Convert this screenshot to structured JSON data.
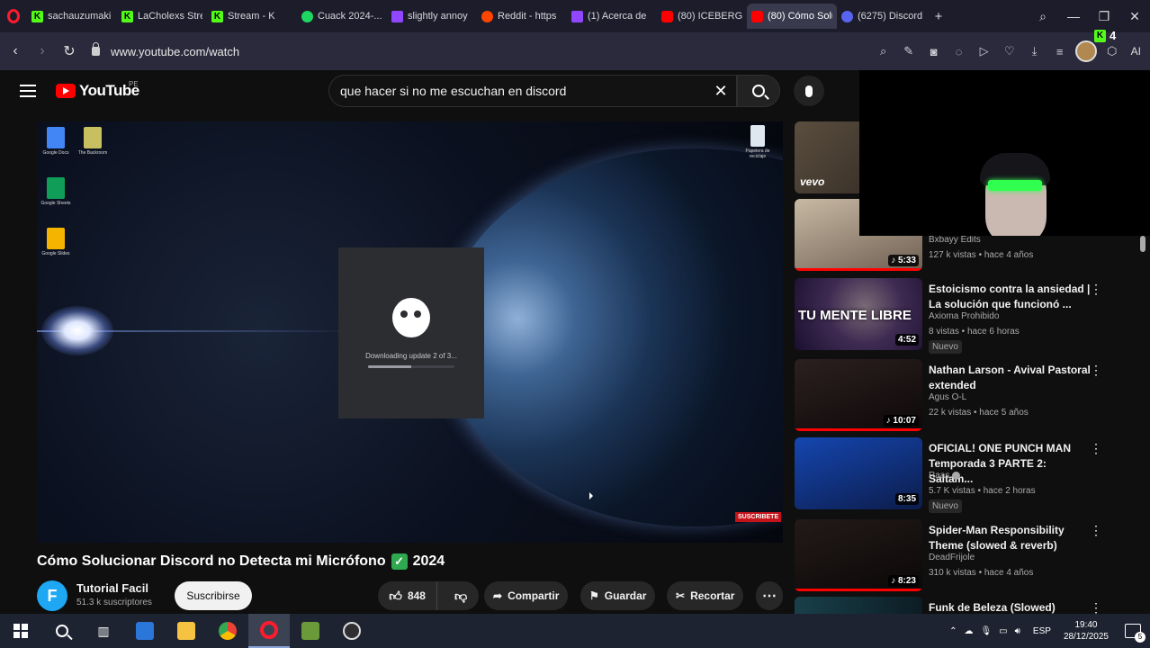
{
  "browser": {
    "tabs": [
      {
        "label": "sachauzumaki",
        "favicon": "kick-icon",
        "active": false
      },
      {
        "label": "LaCholexs Stre",
        "favicon": "kick-icon",
        "active": false
      },
      {
        "label": "Stream - K",
        "favicon": "kick-icon",
        "active": false
      },
      {
        "label": "Cuack 2024-...",
        "favicon": "spotify-icon",
        "active": false
      },
      {
        "label": "slightly annoy",
        "favicon": "twitch-icon",
        "active": false
      },
      {
        "label": "Reddit - https",
        "favicon": "reddit-icon",
        "active": false
      },
      {
        "label": "(1) Acerca de",
        "favicon": "twitch-icon",
        "active": false
      },
      {
        "label": "(80) ICEBERG",
        "favicon": "youtube-icon",
        "active": false
      },
      {
        "label": "(80) Cómo Solucion",
        "favicon": "youtube-icon",
        "active": true
      },
      {
        "label": "(6275) Discord",
        "favicon": "discord-icon",
        "active": false
      }
    ],
    "url": "www.youtube.com/watch",
    "ai_label": "AI",
    "extension_badge": "4"
  },
  "youtube": {
    "logo_text": "YouTube",
    "region": "PE",
    "search_query": "que hacer si no me escuchan en discord",
    "video": {
      "title": "Cómo Solucionar Discord no Detecta mi Micrófono",
      "year": "2024",
      "update_text": "Downloading update 2 of 3...",
      "update_progress": 0.5,
      "subscribe_stamp": "SUSCRIBETE",
      "desktop_icons": [
        "Google Docs",
        "The Backroom",
        "Google Sheets",
        "Google Slides",
        "Papelera de reciclaje"
      ]
    },
    "channel": {
      "name": "Tutorial Facil",
      "subscribers": "51.3 k suscriptores",
      "avatar_letter": "F"
    },
    "actions": {
      "subscribe": "Suscribirse",
      "likes": "848",
      "share": "Compartir",
      "save": "Guardar",
      "clip": "Recortar"
    },
    "recommendations": [
      {
        "title": "",
        "channel": "",
        "meta": "",
        "duration": "",
        "badge": "",
        "thumb_label": "vevo"
      },
      {
        "title": "",
        "channel": "Bxbayy Edits",
        "meta": "127 k vistas • hace 4 años",
        "duration": "♪ 5:33",
        "badge": "",
        "thumb_label": ""
      },
      {
        "title": "Estoicismo contra la ansiedad | La solución que funcionó ...",
        "channel": "Axioma Prohibido",
        "meta": "8 vistas • hace 6 horas",
        "duration": "4:52",
        "badge": "Nuevo",
        "thumb_label": "TU MENTE LIBRE"
      },
      {
        "title": "Nathan Larson - Avival Pastoral extended",
        "channel": "Agus O-L",
        "meta": "22 k vistas • hace 5 años",
        "duration": "♪ 10:07",
        "badge": "",
        "thumb_label": ""
      },
      {
        "title": "OFICIAL! ONE PUNCH MAN Temporada 3 PARTE 2: Saltam...",
        "channel": "Raas",
        "meta": "5.7 K vistas • hace 2 horas",
        "duration": "8:35",
        "badge": "Nuevo",
        "thumb_label": ""
      },
      {
        "title": "Spider-Man Responsibility Theme (slowed & reverb)",
        "channel": "DeadFrijole",
        "meta": "310 k vistas • hace 4 años",
        "duration": "♪ 8:23",
        "badge": "",
        "thumb_label": ""
      },
      {
        "title": "Funk de Beleza (Slowed)",
        "channel": "",
        "meta": "",
        "duration": "",
        "badge": "",
        "thumb_label": ""
      }
    ]
  },
  "taskbar": {
    "language": "ESP",
    "time": "19:40",
    "date": "28/12/2025",
    "notifications": "5"
  },
  "colors": {
    "youtube_red": "#ff0000",
    "kick_green": "#53fc18",
    "discord_blurple": "#5865f2",
    "opera_red": "#ff1b2d"
  }
}
